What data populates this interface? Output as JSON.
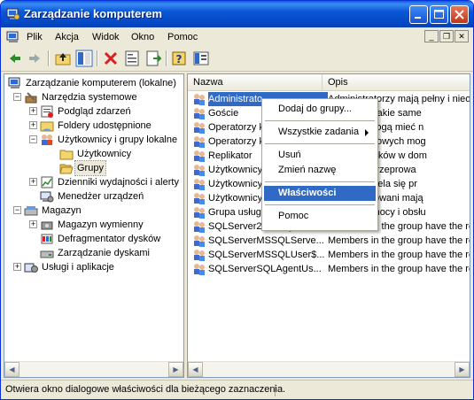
{
  "window": {
    "title": "Zarządzanie komputerem"
  },
  "menu": {
    "items": [
      "Plik",
      "Akcja",
      "Widok",
      "Okno",
      "Pomoc"
    ]
  },
  "toolbar": {
    "icons": [
      "back-arrow-icon",
      "forward-arrow-icon",
      "up-folder-icon",
      "show-hide-tree-icon",
      "delete-icon",
      "properties-icon",
      "export-list-icon",
      "help-icon",
      "console-icon"
    ]
  },
  "tree": {
    "root": "Zarządzanie komputerem (lokalne)",
    "nodes": [
      {
        "label": "Narzędzia systemowe"
      },
      {
        "label": "Podgląd zdarzeń"
      },
      {
        "label": "Foldery udostępnione"
      },
      {
        "label": "Użytkownicy i grupy lokalne"
      },
      {
        "label": "Użytkownicy"
      },
      {
        "label": "Grupy"
      },
      {
        "label": "Dzienniki wydajności i alerty"
      },
      {
        "label": "Menedżer urządzeń"
      },
      {
        "label": "Magazyn"
      },
      {
        "label": "Magazyn wymienny"
      },
      {
        "label": "Defragmentator dysków"
      },
      {
        "label": "Zarządzanie dyskami"
      },
      {
        "label": "Usługi i aplikacje"
      }
    ]
  },
  "list": {
    "columns": [
      "Nazwa",
      "Opis"
    ],
    "rows": [
      {
        "name": "Administrato",
        "desc": "Administratorzy mają pełny i nieo"
      },
      {
        "name": "Goście",
        "desc": "domyślnie takie same"
      },
      {
        "name": "Operatorzy k",
        "desc": "tej grupy mogą mieć n"
      },
      {
        "name": "Operatorzy k",
        "desc": "kopii zapasowych mog"
      },
      {
        "name": "Replikator",
        "desc": "eplikację plików w dom"
      },
      {
        "name": "Użytkownicy",
        "desc": "nie mogą przeprowa"
      },
      {
        "name": "Użytkownicy",
        "desc": "j grupy udziela się pr"
      },
      {
        "name": "Użytkownicy",
        "desc": "y zaawansowani mają"
      },
      {
        "name": "Grupa usług",
        "desc": "entrum pomocy i obsłu"
      },
      {
        "name": "SQLServer2005SQLBro...",
        "desc": "Members in the group have the re"
      },
      {
        "name": "SQLServerMSSQLServe...",
        "desc": "Members in the group have the re"
      },
      {
        "name": "SQLServerMSSQLUser$...",
        "desc": "Members in the group have the re"
      },
      {
        "name": "SQLServerSQLAgentUs...",
        "desc": "Members in the group have the re"
      }
    ]
  },
  "context_menu": {
    "items": [
      "Dodaj do grupy...",
      "Wszystkie zadania",
      "Usuń",
      "Zmień nazwę",
      "Właściwości",
      "Pomoc"
    ]
  },
  "status": {
    "text": "Otwiera okno dialogowe właściwości dla bieżącego zaznaczenia."
  }
}
